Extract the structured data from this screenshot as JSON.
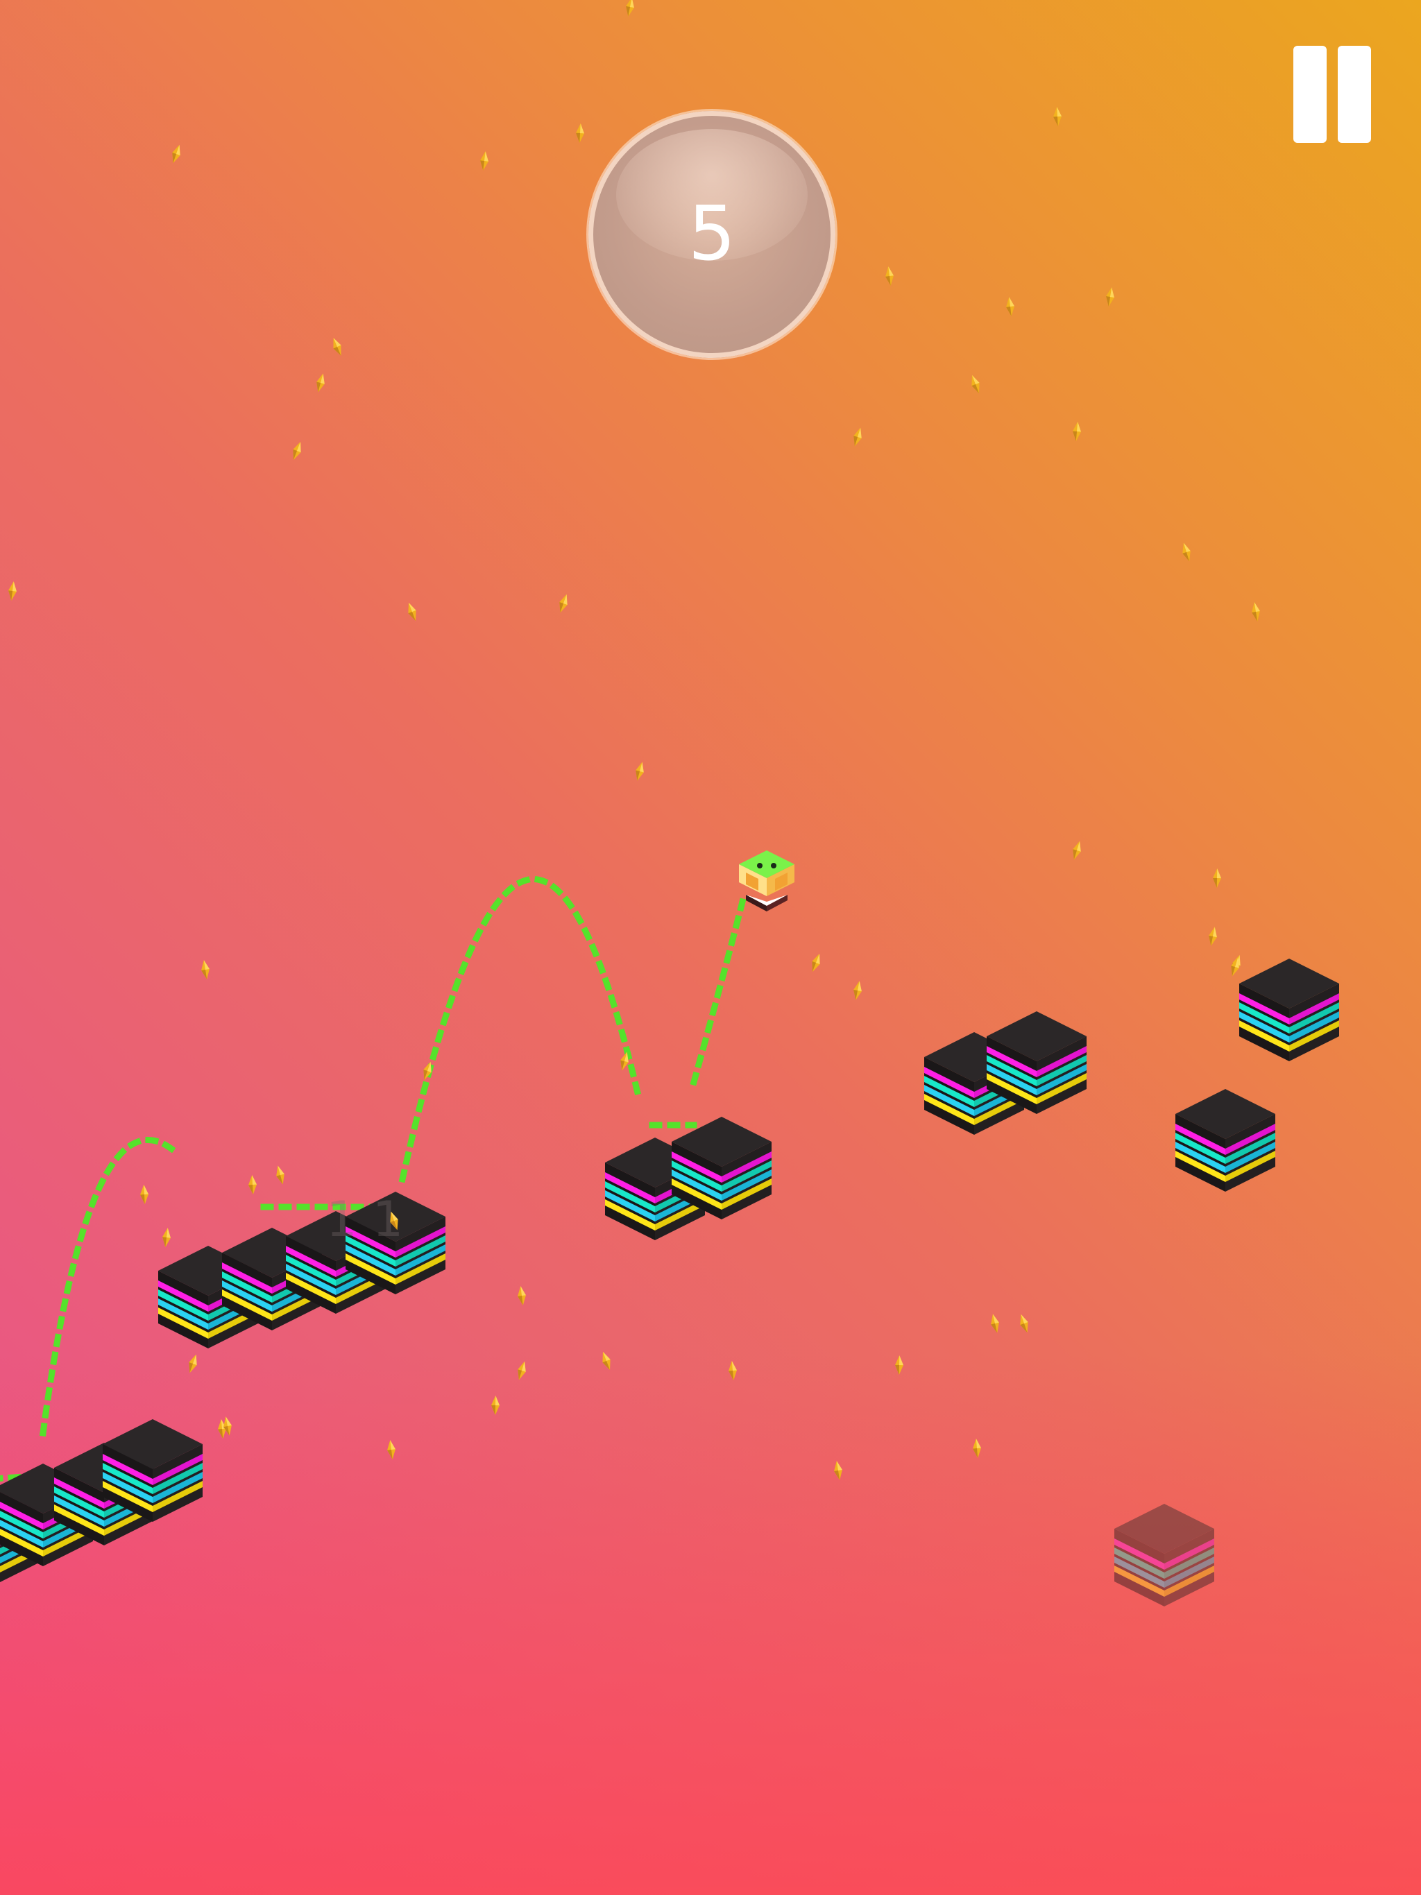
{
  "hud": {
    "score": "5",
    "pause_icon": "pause-icon"
  },
  "colors": {
    "background_top_right": "#EBA61F",
    "background_bottom_left": "#E94E93",
    "block_top": "#2A2627",
    "block_stripes": [
      "#FF00FF",
      "#00E5D4",
      "#2DD4F0",
      "#FFE600",
      "#1A1A1A"
    ],
    "trail": "#55E22B",
    "player": "#6BE83A",
    "gem": "#F2B21E"
  },
  "trail_label": "1 1"
}
